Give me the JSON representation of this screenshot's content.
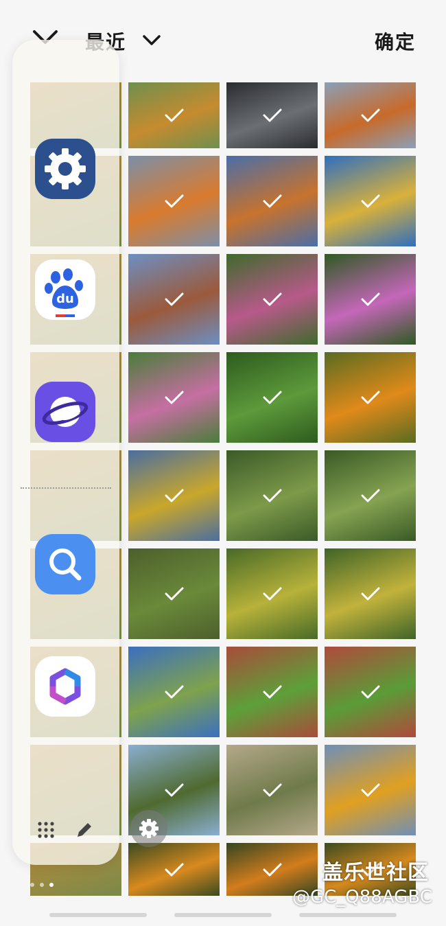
{
  "header": {
    "album_title": "最近",
    "confirm_label": "确定",
    "back_icon": "chevron-down-icon",
    "album_dropdown_icon": "chevron-down-icon"
  },
  "photos": [
    {
      "scene": "autumn-trees",
      "c1": "#c58b2f",
      "c2": "#6f8f4f",
      "selected": true
    },
    {
      "scene": "street-car",
      "c1": "#6b6f74",
      "c2": "#2b2c30",
      "selected": true
    },
    {
      "scene": "orange-tree",
      "c1": "#c86a2a",
      "c2": "#8aa0b8",
      "selected": true
    },
    {
      "scene": "orange-tree-building",
      "c1": "#d97b2e",
      "c2": "#7b8fa8",
      "selected": true
    },
    {
      "scene": "orange-tree-store",
      "c1": "#c7732d",
      "c2": "#4a6ea8",
      "selected": true
    },
    {
      "scene": "yellow-tree-store",
      "c1": "#d9b13a",
      "c2": "#2f6fbf",
      "selected": true
    },
    {
      "scene": "building-trees",
      "c1": "#9b5a3c",
      "c2": "#6d8fc2",
      "selected": true
    },
    {
      "scene": "pink-flowers",
      "c1": "#b75a8a",
      "c2": "#3f6a2c",
      "selected": true
    },
    {
      "scene": "cosmos-closeup",
      "c1": "#c467b9",
      "c2": "#2f5a22",
      "selected": true
    },
    {
      "scene": "flower-field",
      "c1": "#c56fa2",
      "c2": "#4a7d3a",
      "selected": true
    },
    {
      "scene": "green-plants",
      "c1": "#5d9a3b",
      "c2": "#2e5b1e",
      "selected": true
    },
    {
      "scene": "orange-flowers",
      "c1": "#e08a1a",
      "c2": "#5a6b22",
      "selected": true
    },
    {
      "scene": "ginkgo",
      "c1": "#c9a72a",
      "c2": "#4b6ea0",
      "selected": true
    },
    {
      "scene": "bamboo",
      "c1": "#7d9a4a",
      "c2": "#3b5a28",
      "selected": true
    },
    {
      "scene": "bamboo-2",
      "c1": "#86a352",
      "c2": "#3a5a26",
      "selected": true
    },
    {
      "scene": "forest",
      "c1": "#6a8a3a",
      "c2": "#4d5f2c",
      "selected": true
    },
    {
      "scene": "ginkgo-2",
      "c1": "#b7b23a",
      "c2": "#496a28",
      "selected": true
    },
    {
      "scene": "ginkgo-3",
      "c1": "#c2b23c",
      "c2": "#3f6428",
      "selected": true
    },
    {
      "scene": "park-trees",
      "c1": "#7fa24c",
      "c2": "#3b6fc0",
      "selected": true
    },
    {
      "scene": "park-path",
      "c1": "#5da03a",
      "c2": "#a84c3a",
      "selected": true
    },
    {
      "scene": "park-path-2",
      "c1": "#5a9c38",
      "c2": "#b04a3c",
      "selected": true
    },
    {
      "scene": "woods",
      "c1": "#4f6a30",
      "c2": "#8aaed0",
      "selected": true
    },
    {
      "scene": "trail",
      "c1": "#6f7a4a",
      "c2": "#b4a88a",
      "selected": true
    },
    {
      "scene": "marigold-field",
      "c1": "#e0a020",
      "c2": "#6f8fb8",
      "selected": true
    },
    {
      "scene": "marigold-1",
      "c1": "#d88a1e",
      "c2": "#3a4a22",
      "selected": true
    },
    {
      "scene": "marigold-2",
      "c1": "#d27d1c",
      "c2": "#354622",
      "selected": true
    },
    {
      "scene": "marigold-3",
      "c1": "#d6891e",
      "c2": "#3b4a20",
      "selected": true
    },
    {
      "scene": "marigold-4",
      "c1": "#d68720",
      "c2": "#7aa0c8",
      "selected": true
    }
  ],
  "edge_panel": {
    "apps": [
      {
        "name": "settings",
        "icon": "gear-icon",
        "bg": "#2c5aa0"
      },
      {
        "name": "baidu",
        "icon": "paw-icon",
        "bg": "#ffffff",
        "label": "du"
      },
      {
        "name": "browser",
        "icon": "planet-icon",
        "bg": "#6b4fe0"
      },
      {
        "name": "search",
        "icon": "search-icon",
        "bg": "#4a90f0"
      },
      {
        "name": "copilot",
        "icon": "copilot-icon",
        "bg": "#ffffff"
      }
    ],
    "grid_icon": "grid-dots-icon",
    "edit_icon": "pencil-icon",
    "settings_icon": "gear-icon"
  },
  "watermark": {
    "title": "盖乐世社区",
    "user": "@GC_Q88AGBC"
  }
}
